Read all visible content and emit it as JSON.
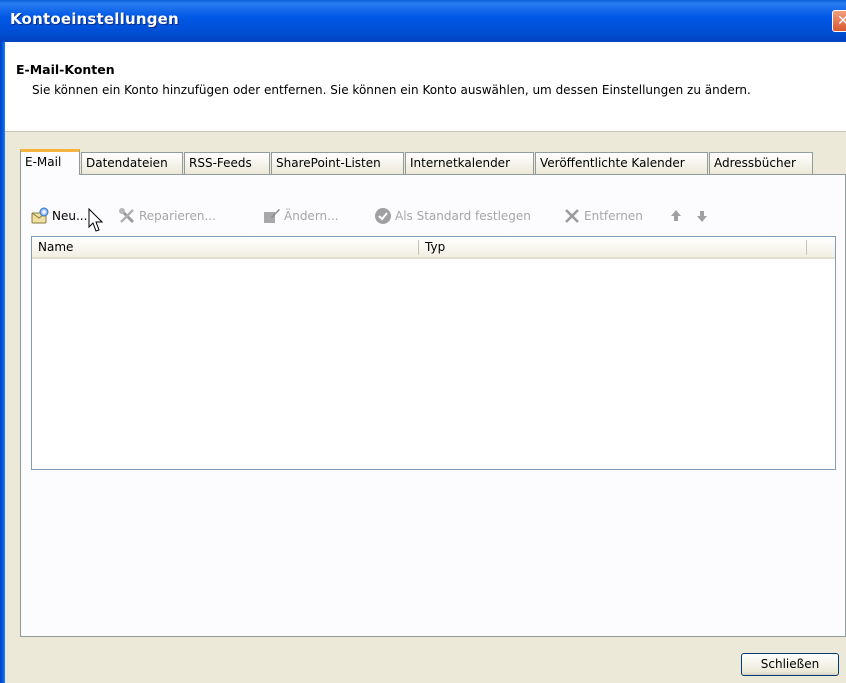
{
  "window": {
    "title": "Kontoeinstellungen",
    "close_symbol": "✕"
  },
  "header": {
    "title": "E-Mail-Konten",
    "description": "Sie können ein Konto hinzufügen oder entfernen. Sie können ein Konto auswählen, um dessen Einstellungen zu ändern."
  },
  "tabs": [
    {
      "label": "E-Mail",
      "active": true
    },
    {
      "label": "Datendateien",
      "active": false
    },
    {
      "label": "RSS-Feeds",
      "active": false
    },
    {
      "label": "SharePoint-Listen",
      "active": false
    },
    {
      "label": "Internetkalender",
      "active": false
    },
    {
      "label": "Veröffentlichte Kalender",
      "active": false
    },
    {
      "label": "Adressbücher",
      "active": false
    }
  ],
  "toolbar": {
    "new_label": "Neu...",
    "repair_label": "Reparieren...",
    "change_label": "Ändern...",
    "set_default_label": "Als Standard festlegen",
    "remove_label": "Entfernen",
    "up_icon": "arrow-up-icon",
    "down_icon": "arrow-down-icon"
  },
  "account_list": {
    "columns": [
      "Name",
      "Typ"
    ],
    "rows": []
  },
  "footer": {
    "close_label": "Schließen"
  },
  "colors": {
    "titlebar": "#0058e6",
    "dialog_bg": "#ece9d8",
    "active_tab_accent": "#f5b440",
    "disabled_text": "#a6a6a6"
  }
}
